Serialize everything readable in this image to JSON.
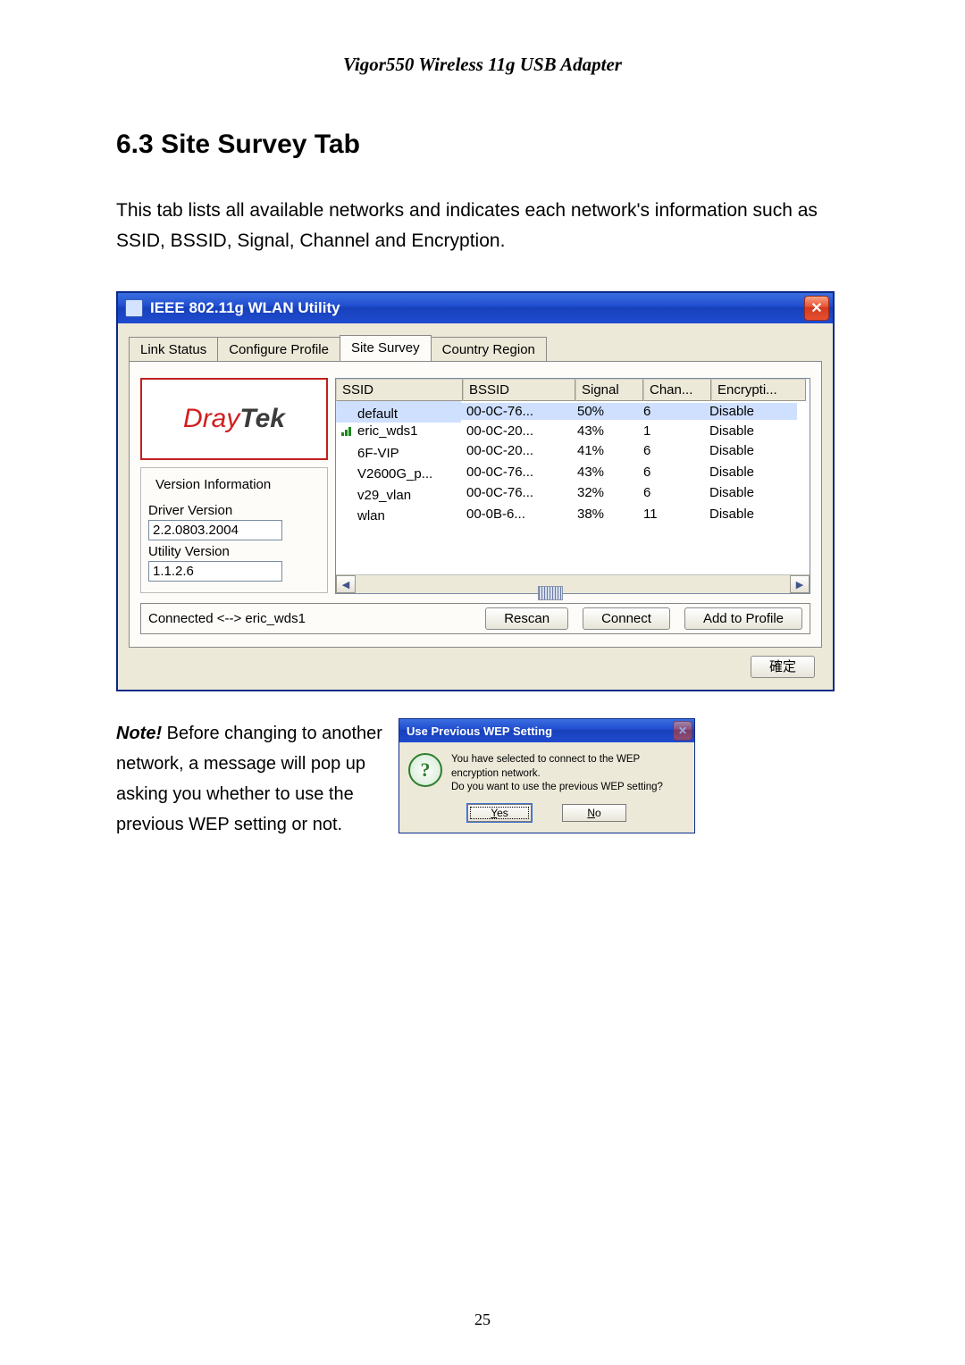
{
  "doc": {
    "header": "Vigor550 Wireless 11g USB Adapter",
    "section_number": "6.3",
    "section_title": "Site Survey Tab",
    "intro": "This tab lists all available networks and indicates each network's information such as SSID, BSSID, Signal, Channel and Encryption.",
    "note_label": "Note!",
    "note_body": " Before changing to another network, a message will pop up asking you whether to use the previous WEP setting or not.",
    "page_number": "25"
  },
  "window": {
    "title": "IEEE 802.11g WLAN Utility",
    "tabs": [
      "Link Status",
      "Configure Profile",
      "Site Survey",
      "Country Region"
    ],
    "active_tab": 2,
    "logo_left": "Dray",
    "logo_right": "Tek",
    "version_group": {
      "title": "Version Information",
      "driver_label": "Driver Version",
      "driver_value": "2.2.0803.2004",
      "utility_label": "Utility Version",
      "utility_value": "1.1.2.6"
    },
    "columns": [
      "SSID",
      "BSSID",
      "Signal",
      "Chan...",
      "Encrypti..."
    ],
    "rows": [
      {
        "ssid": "default",
        "bssid": "00-0C-76...",
        "signal": "50%",
        "chan": "6",
        "enc": "Disable",
        "selected": true,
        "icon": false
      },
      {
        "ssid": "eric_wds1",
        "bssid": "00-0C-20...",
        "signal": "43%",
        "chan": "1",
        "enc": "Disable",
        "selected": false,
        "icon": true
      },
      {
        "ssid": "6F-VIP",
        "bssid": "00-0C-20...",
        "signal": "41%",
        "chan": "6",
        "enc": "Disable",
        "selected": false,
        "icon": false
      },
      {
        "ssid": "V2600G_p...",
        "bssid": "00-0C-76...",
        "signal": "43%",
        "chan": "6",
        "enc": "Disable",
        "selected": false,
        "icon": false
      },
      {
        "ssid": "v29_vlan",
        "bssid": "00-0C-76...",
        "signal": "32%",
        "chan": "6",
        "enc": "Disable",
        "selected": false,
        "icon": false
      },
      {
        "ssid": "wlan",
        "bssid": "00-0B-6...",
        "signal": "38%",
        "chan": "11",
        "enc": "Disable",
        "selected": false,
        "icon": false
      }
    ],
    "status_text": "Connected <--> eric_wds1",
    "buttons": {
      "rescan": "Rescan",
      "connect": "Connect",
      "add": "Add to Profile",
      "ok": "確定"
    }
  },
  "dialog": {
    "title": "Use Previous WEP Setting",
    "line1": "You have selected to connect to the WEP encryption network.",
    "line2": "Do you want to use the previous WEP setting?",
    "yes": "Yes",
    "no": "No"
  }
}
